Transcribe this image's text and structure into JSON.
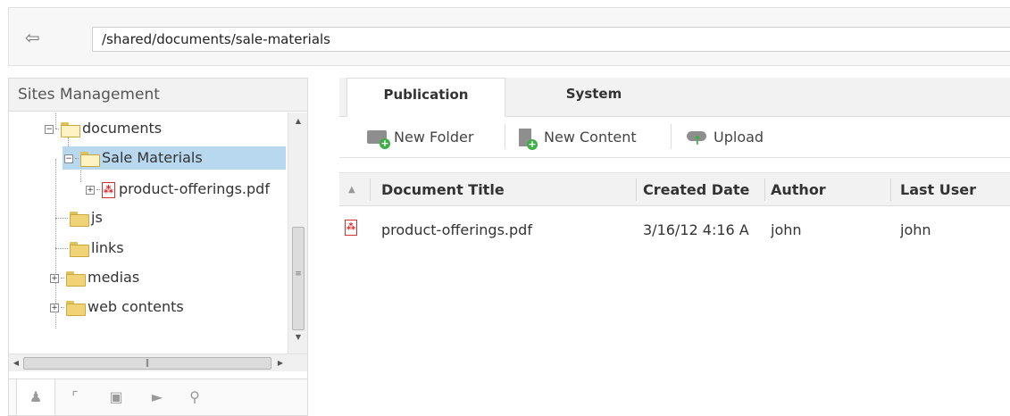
{
  "path_bar": {
    "back_icon": "back-arrow-icon",
    "path": "/shared/documents/sale-materials"
  },
  "left_panel": {
    "title": "Sites Management",
    "tree": [
      {
        "label": "documents",
        "icon": "folder-open-icon",
        "expanded": true
      },
      {
        "label": "Sale Materials",
        "icon": "folder-open-icon",
        "expanded": true,
        "selected": true
      },
      {
        "label": "product-offerings.pdf",
        "icon": "pdf-icon",
        "expanded": false
      },
      {
        "label": "js",
        "icon": "js-folder-icon"
      },
      {
        "label": "links",
        "icon": "links-folder-icon"
      },
      {
        "label": "medias",
        "icon": "media-folder-icon",
        "expanded": false
      },
      {
        "label": "web contents",
        "icon": "html-folder-icon",
        "expanded": false
      }
    ],
    "bottom_tabs": [
      "sitemap-icon",
      "tree-icon",
      "clipboard-icon",
      "tag-icon",
      "search-icon"
    ]
  },
  "tabs": [
    {
      "label": "Publication",
      "active": true
    },
    {
      "label": "System",
      "active": false
    }
  ],
  "toolbar": {
    "new_folder": "New Folder",
    "new_content": "New Content",
    "upload": "Upload"
  },
  "grid": {
    "columns": [
      "Document Title",
      "Created Date",
      "Author",
      "Last User"
    ],
    "rows": [
      {
        "title": "product-offerings.pdf",
        "created": "3/16/12 4:16 A",
        "author": "john",
        "last_user": "john"
      }
    ]
  },
  "colors": {
    "selected_row": "#b8d8f0",
    "accent_green": "#3fae49",
    "pdf_red": "#d22222"
  }
}
